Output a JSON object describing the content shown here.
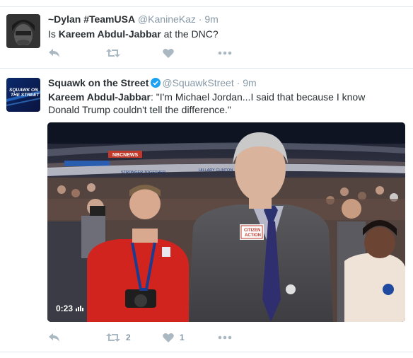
{
  "tweets": [
    {
      "name": "~Dylan #TeamUSA",
      "handle": "@KanineKaz",
      "separator": "·",
      "time": "9m",
      "text_pre": "Is ",
      "text_bold": "Kareem Abdul-Jabbar",
      "text_post": " at the DNC?",
      "actions": {
        "reply_icon": "reply-icon",
        "retweet_icon": "retweet-icon",
        "like_icon": "heart-icon",
        "more_icon": "more-dots-icon"
      }
    },
    {
      "name": "Squawk on the Street",
      "verified": true,
      "handle": "@SquawkStreet",
      "separator": "·",
      "time": "9m",
      "avatar_text_1": "SQUAWK ON",
      "avatar_text_2": "THE STREET",
      "text_bold": "Kareem Abdul-Jabbar",
      "text_line1_post": ": \"I'm Michael Jordan...I said that because I know",
      "text_line2": "Donald Trump couldn't tell the difference.\"",
      "media": {
        "duration": "0:23",
        "banner_news": "NBCNEWS",
        "banner_stronger": "STRONGER TOGETHER",
        "banner_hillary": "HILLARY CLINTON",
        "badge_line1": "CITIZEN",
        "badge_line2": "ACTION"
      },
      "retweet_count": "2",
      "like_count": "1",
      "colors": {
        "verified": "#1da1f2"
      }
    }
  ]
}
